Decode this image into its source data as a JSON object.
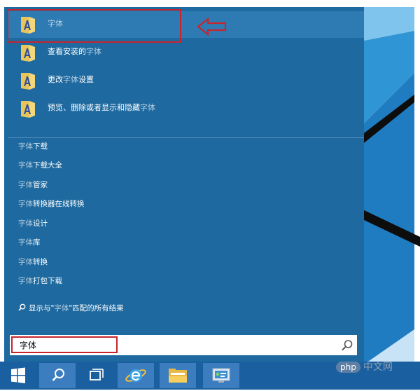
{
  "results": [
    {
      "before": "",
      "highlight": "字体",
      "after": ""
    },
    {
      "before": "查看安装的",
      "highlight": "字体",
      "after": ""
    },
    {
      "before": "更改",
      "highlight": "字体",
      "after": "设置"
    },
    {
      "before": "预览、删除或者显示和隐藏",
      "highlight": "字体",
      "after": ""
    }
  ],
  "web_suggestions": [
    {
      "highlight": "字体",
      "rest": "下载"
    },
    {
      "highlight": "字体",
      "rest": "下载大全"
    },
    {
      "highlight": "字体",
      "rest": "管家"
    },
    {
      "highlight": "字体",
      "rest": "转换器在线转换"
    },
    {
      "highlight": "字体",
      "rest": "设计"
    },
    {
      "highlight": "字体",
      "rest": "库"
    },
    {
      "highlight": "字体",
      "rest": "转换"
    },
    {
      "highlight": "字体",
      "rest": "打包下载"
    }
  ],
  "show_all": {
    "before": "显示与\"",
    "highlight": "字体",
    "after": "\"匹配的所有结果"
  },
  "search": {
    "value": "字体"
  },
  "watermark": {
    "logo": "php",
    "text": "中文网"
  },
  "icons": {
    "folder": "font-folder-icon",
    "arrow": "left-arrow-annotation",
    "search": "search-icon",
    "windows": "windows-logo-icon",
    "task_view": "task-view-icon",
    "ie": "internet-explorer-icon",
    "explorer": "file-explorer-icon",
    "control_panel": "control-panel-icon"
  },
  "colors": {
    "panel": "#1e6aa0",
    "highlight_text": "#b9d1e3",
    "taskbar": "#1a5fa0",
    "annotation_red": "#c8242c"
  }
}
